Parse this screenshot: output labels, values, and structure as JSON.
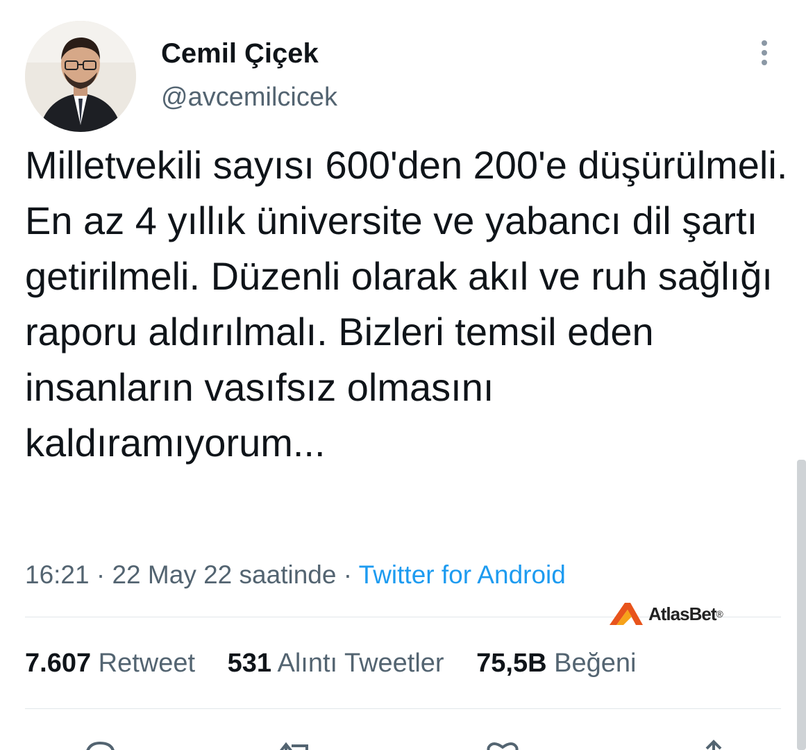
{
  "user": {
    "display_name": "Cemil Çiçek",
    "handle": "@avcemilcicek"
  },
  "tweet": {
    "text": "Milletvekili sayısı 600'den 200'e düşürülmeli. En az 4 yıllık üniversite ve yabancı dil şartı getirilmeli. Düzenli olarak akıl ve ruh sağlığı raporu aldırılmalı. Bizleri temsil eden insanların vasıfsız olmasını kaldıramıyorum..."
  },
  "meta": {
    "time": "16:21",
    "date_text": "22 May 22 saatinde",
    "separator": "·",
    "source": "Twitter for Android"
  },
  "watermark": {
    "text": "AtlasBet",
    "mark": "®"
  },
  "stats": {
    "retweets_count": "7.607",
    "retweets_label": "Retweet",
    "quotes_count": "531",
    "quotes_label": "Alıntı Tweetler",
    "likes_count": "75,5B",
    "likes_label": "Beğeni"
  },
  "icons": {
    "more": "more-vertical-icon",
    "reply": "reply-icon",
    "retweet": "retweet-icon",
    "like": "heart-icon",
    "share": "share-icon"
  },
  "colors": {
    "text": "#0f1419",
    "secondary": "#536471",
    "link": "#1d9bf0",
    "divider": "#e1e6ea",
    "watermark_accent": "#e8541c"
  }
}
